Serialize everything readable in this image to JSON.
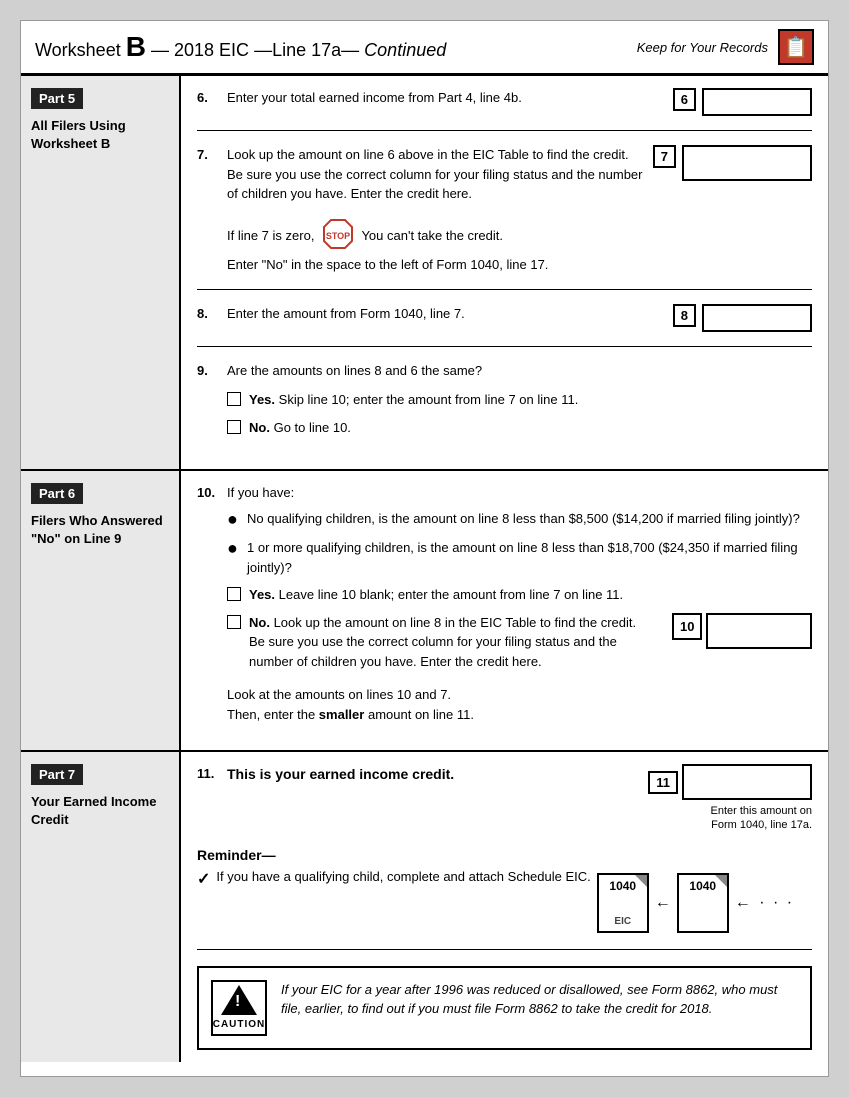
{
  "header": {
    "worksheet_label": "Worksheet",
    "bold_b": "B",
    "dash": "—",
    "year": "2018",
    "form": "EIC",
    "line": "Line 17a",
    "continued": "Continued",
    "keep_records": "Keep for Your Records"
  },
  "part5": {
    "badge": "Part 5",
    "title": "All Filers Using Worksheet B",
    "lines": {
      "line6": {
        "number": "6.",
        "text": "Enter your total earned income from Part 4, line 4b.",
        "label": "6"
      },
      "line7": {
        "number": "7.",
        "text": "Look up the amount on line 6 above in the EIC Table to find the credit. Be sure you use the correct column for your filing status and the number of children you have. Enter the credit here.",
        "label": "7",
        "stop_text": "If line 7 is zero,",
        "stop_after": "You can't take the credit.",
        "stop_note": "Enter \"No\" in the space to the left of Form 1040, line 17."
      },
      "line8": {
        "number": "8.",
        "text": "Enter the amount from Form 1040, line 7.",
        "label": "8"
      },
      "line9": {
        "number": "9.",
        "text": "Are the amounts on lines 8 and 6 the same?",
        "yes_label": "Yes.",
        "yes_text": "Skip line 10; enter the amount from line 7 on line 11.",
        "no_label": "No.",
        "no_text": "Go to line 10."
      }
    }
  },
  "part6": {
    "badge": "Part 6",
    "title": "Filers Who Answered \"No\" on Line 9",
    "lines": {
      "line10": {
        "number": "10.",
        "intro": "If you have:",
        "bullet1": "No qualifying children, is the amount on line 8 less than $8,500 ($14,200 if married filing jointly)?",
        "bullet2": "1 or more qualifying children, is the amount on line 8 less than $18,700 ($24,350 if married filing jointly)?",
        "yes_label": "Yes.",
        "yes_text": "Leave line 10 blank; enter the amount from line 7 on line 11.",
        "no_label": "No.",
        "no_text": "Look up the amount on line 8 in the EIC Table to find the credit. Be sure you use the correct column for your filing status and the number of children you have. Enter the credit here.",
        "label": "10",
        "footer1": "Look at the amounts on lines 10 and 7.",
        "footer2": "Then, enter the",
        "footer_bold": "smaller",
        "footer3": "amount on line 11."
      }
    }
  },
  "part7": {
    "badge": "Part 7",
    "title": "Your Earned Income Credit",
    "lines": {
      "line11": {
        "number": "11.",
        "text": "This is your earned income credit.",
        "label": "11",
        "note1": "Enter this amount on",
        "note2": "Form 1040, line 17a."
      }
    },
    "reminder": {
      "title": "Reminder—",
      "check": "✓",
      "text": "If you have a qualifying child, complete and attach Schedule EIC.",
      "form1040_label": "1040",
      "form1040_sub": "",
      "form_eic_label": "EIC",
      "form1040_2_label": "1040"
    },
    "caution": {
      "label": "CAUTION",
      "text": "If your EIC for a year after 1996 was reduced or disallowed, see Form 8862, who must file, earlier, to find out if you must file Form 8862 to take the credit for 2018."
    }
  }
}
